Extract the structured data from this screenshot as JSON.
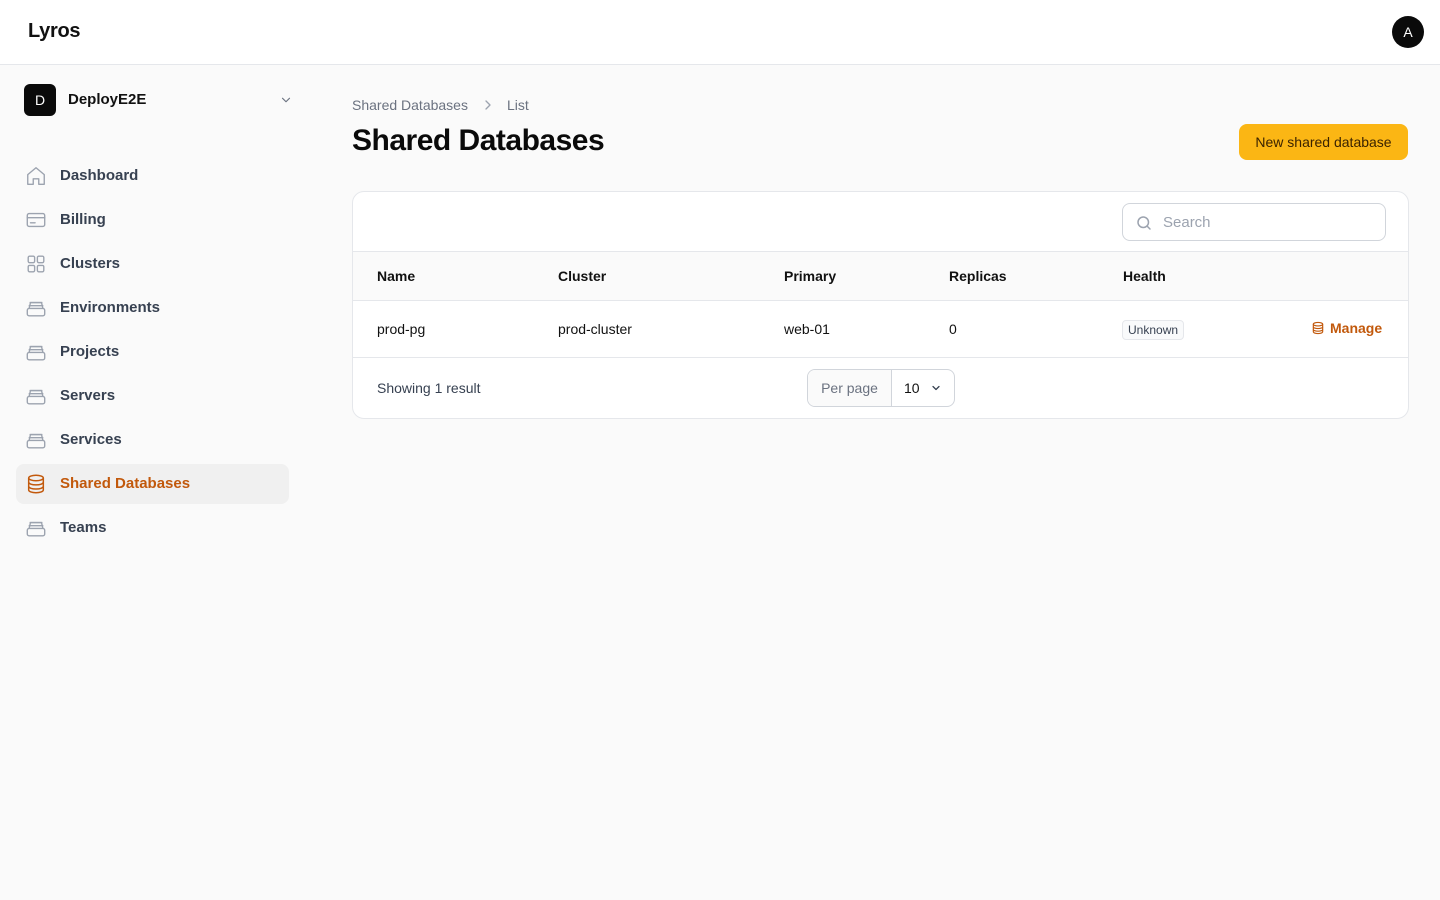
{
  "app": {
    "brand": "Lyros",
    "user_initial": "A"
  },
  "tenant": {
    "initial": "D",
    "name": "DeployE2E"
  },
  "sidebar": {
    "items": [
      {
        "label": "Dashboard",
        "icon": "home-icon",
        "active": false
      },
      {
        "label": "Billing",
        "icon": "credit-card-icon",
        "active": false
      },
      {
        "label": "Clusters",
        "icon": "grid-icon",
        "active": false
      },
      {
        "label": "Environments",
        "icon": "box-icon",
        "active": false
      },
      {
        "label": "Projects",
        "icon": "box-icon",
        "active": false
      },
      {
        "label": "Servers",
        "icon": "box-icon",
        "active": false
      },
      {
        "label": "Services",
        "icon": "box-icon",
        "active": false
      },
      {
        "label": "Shared Databases",
        "icon": "database-icon",
        "active": true
      },
      {
        "label": "Teams",
        "icon": "box-icon",
        "active": false
      }
    ]
  },
  "breadcrumb": {
    "parent": "Shared Databases",
    "current": "List"
  },
  "page": {
    "title": "Shared Databases",
    "new_button": "New shared database"
  },
  "search": {
    "placeholder": "Search",
    "value": ""
  },
  "table": {
    "columns": [
      "Name",
      "Cluster",
      "Primary",
      "Replicas",
      "Health"
    ],
    "rows": [
      {
        "name": "prod-pg",
        "cluster": "prod-cluster",
        "primary": "web-01",
        "replicas": "0",
        "health": "Unknown",
        "action": "Manage"
      }
    ]
  },
  "footer": {
    "showing": "Showing 1 result",
    "per_page_label": "Per page",
    "per_page_value": "10"
  },
  "colors": {
    "accent": "#c2590c",
    "primary_button": "#fbb614"
  }
}
